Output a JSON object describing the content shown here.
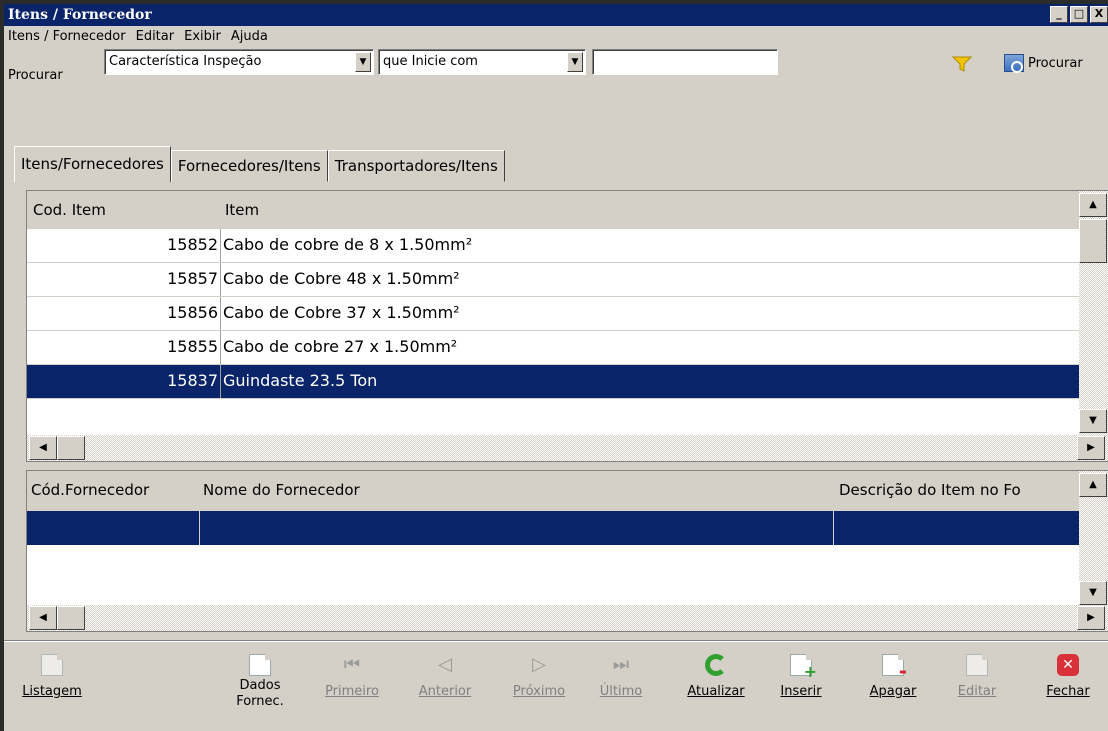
{
  "window": {
    "title": "Itens / Fornecedor",
    "minimize_glyph": "_",
    "maximize_glyph": "□",
    "close_glyph": "X"
  },
  "menu": [
    {
      "label": "Itens / Fornecedor"
    },
    {
      "label": "Editar"
    },
    {
      "label": "Exibir"
    },
    {
      "label": "Ajuda"
    }
  ],
  "search": {
    "label": "Procurar",
    "field_value": "Característica Inspeção",
    "mode_value": "que Inicie com",
    "text_value": "",
    "button_label": "Procurar"
  },
  "tabs": [
    {
      "label": "Itens/Fornecedores",
      "active": true
    },
    {
      "label": "Fornecedores/Itens",
      "active": false
    },
    {
      "label": "Transportadores/Itens",
      "active": false
    }
  ],
  "items_grid": {
    "columns": [
      "Cod. Item",
      "Item"
    ],
    "rows": [
      {
        "cod": "15852",
        "item": "Cabo de cobre de 8 x 1.50mm²",
        "selected": false
      },
      {
        "cod": "15857",
        "item": "Cabo de Cobre 48 x 1.50mm²",
        "selected": false
      },
      {
        "cod": "15856",
        "item": "Cabo de Cobre 37 x 1.50mm²",
        "selected": false
      },
      {
        "cod": "15855",
        "item": "Cabo de cobre 27 x 1.50mm²",
        "selected": false
      },
      {
        "cod": "15837",
        "item": "Guindaste 23.5 Ton",
        "selected": true
      }
    ]
  },
  "suppliers_grid": {
    "columns": [
      "Cód.Fornecedor",
      "Nome do Fornecedor",
      "Descrição do Item no Fo"
    ]
  },
  "toolbar": {
    "listagem": "Listagem",
    "dados_fornec": "Dados\nFornec.",
    "primeiro": "Primeiro",
    "anterior": "Anterior",
    "proximo": "Próximo",
    "ultimo": "Último",
    "atualizar": "Atualizar",
    "inserir": "Inserir",
    "apagar": "Apagar",
    "editar": "Editar",
    "fechar": "Fechar"
  },
  "icons": {
    "filter": "filter-icon",
    "search": "search-icon",
    "close": "close-icon"
  },
  "colors": {
    "titlebar": "#0a246a",
    "selection": "#0a246a",
    "face": "#d4d0c8"
  }
}
